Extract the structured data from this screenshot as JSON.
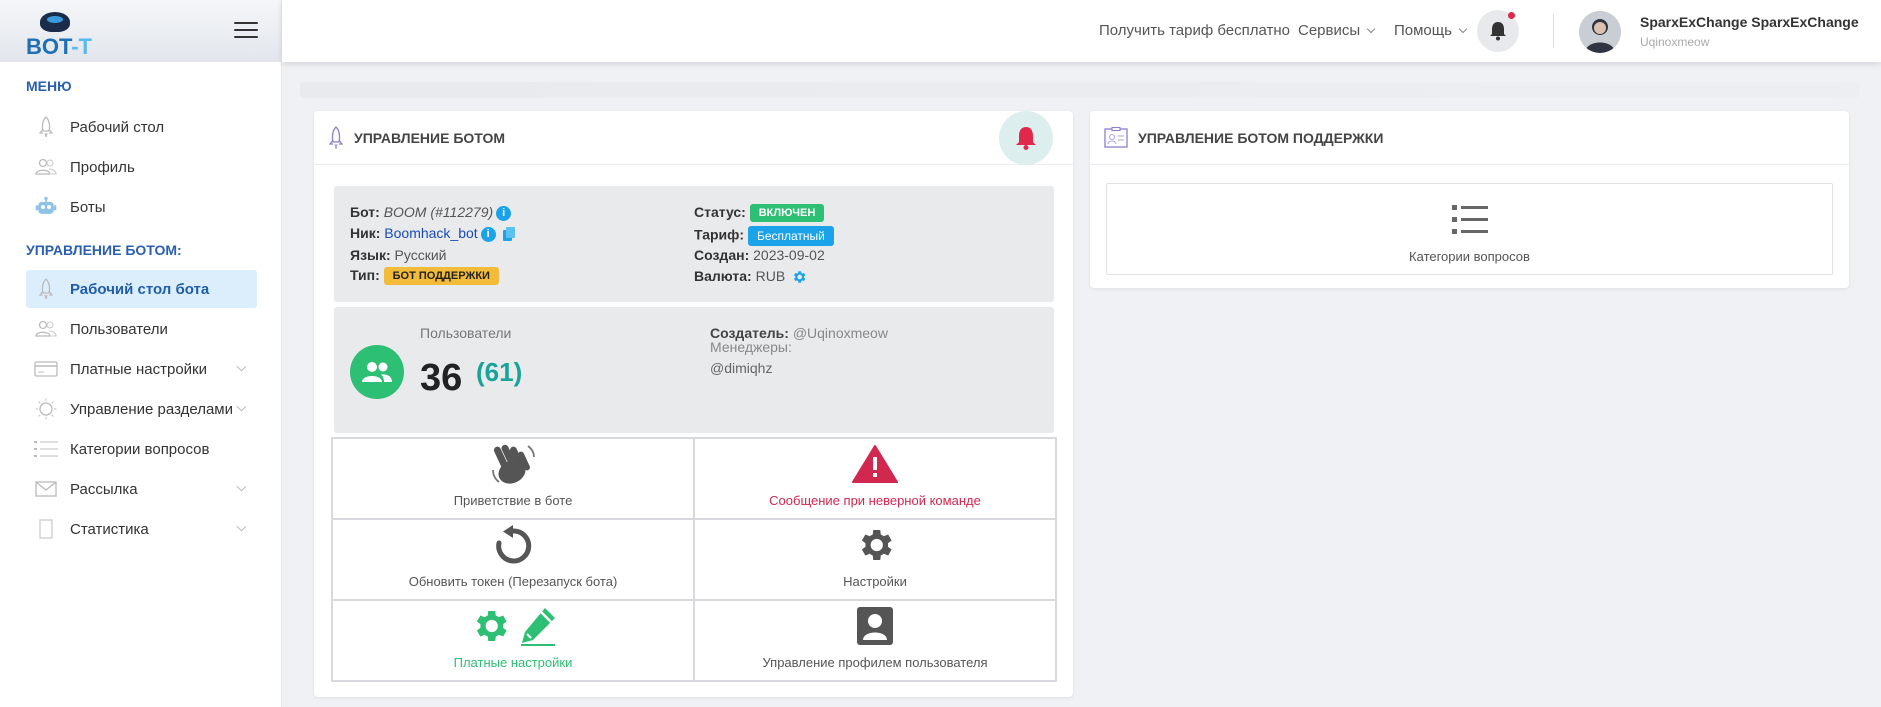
{
  "brand": {
    "logo_main": "BOT",
    "logo_accent": "-T"
  },
  "sidebar": {
    "section_menu": "МЕНЮ",
    "menu_items": [
      {
        "label": "Рабочий стол",
        "icon": "rocket-icon"
      },
      {
        "label": "Профиль",
        "icon": "users-icon"
      },
      {
        "label": "Боты",
        "icon": "robot-icon"
      }
    ],
    "section_bot": "УПРАВЛЕНИЕ БОТОМ:",
    "bot_items": [
      {
        "label": "Рабочий стол бота",
        "icon": "rocket-icon",
        "active": true
      },
      {
        "label": "Пользователи",
        "icon": "users-icon"
      },
      {
        "label": "Платные настройки",
        "icon": "card-icon",
        "expandable": true
      },
      {
        "label": "Управление разделами",
        "icon": "sun-icon",
        "expandable": true
      },
      {
        "label": "Категории вопросов",
        "icon": "list-icon"
      },
      {
        "label": "Рассылка",
        "icon": "mail-icon",
        "expandable": true
      },
      {
        "label": "Статистика",
        "icon": "chart-icon",
        "expandable": true
      }
    ]
  },
  "topbar": {
    "free_tariff": "Получить тариф бесплатно",
    "services": "Сервисы",
    "help": "Помощь",
    "user_name": "SparxExChange SparxExChange",
    "user_handle": "Uqinoxmeow"
  },
  "bot_card": {
    "title": "УПРАВЛЕНИЕ БОТОМ",
    "bot_label": "Бот:",
    "bot_value": "BOOM (#112279)",
    "nick_label": "Ник:",
    "nick_value": "Boomhack_bot",
    "lang_label": "Язык:",
    "lang_value": "Русский",
    "type_label": "Тип:",
    "type_value": "БОТ ПОДДЕРЖКИ",
    "status_label": "Статус:",
    "status_value": "ВКЛЮЧЕН",
    "tariff_label": "Тариф:",
    "tariff_value": "Бесплатный",
    "created_label": "Создан:",
    "created_value": "2023-09-02",
    "currency_label": "Валюта:",
    "currency_value": "RUB",
    "users_label": "Пользователи",
    "users_count": "36",
    "users_total": "(61)",
    "creator_label": "Создатель:",
    "creator_value": "@Uqinoxmeow",
    "managers_label": "Менеджеры:",
    "managers_value": "@dimiqhz",
    "tiles": [
      {
        "label": "Приветствие в боте",
        "icon": "waving-hand-icon",
        "color": "#555555"
      },
      {
        "label": "Сообщение при неверной команде",
        "icon": "warning-icon",
        "color": "#d0284f"
      },
      {
        "label": "Обновить токен (Перезапуск бота)",
        "icon": "refresh-icon",
        "color": "#555555"
      },
      {
        "label": "Настройки",
        "icon": "gear-icon",
        "color": "#555555"
      },
      {
        "label": "Платные настройки",
        "icon": "gear-edit-icon",
        "color": "#2dbf73"
      },
      {
        "label": "Управление профилем пользователя",
        "icon": "user-profile-icon",
        "color": "#555555"
      }
    ]
  },
  "support_card": {
    "title": "УПРАВЛЕНИЕ БОТОМ ПОДДЕРЖКИ",
    "category_label": "Категории вопросов"
  },
  "colors": {
    "accent": "#2a5fb0",
    "active_bg": "#dceefc",
    "green": "#2dbf73",
    "red": "#d0284f",
    "blue": "#1aa3e8"
  }
}
